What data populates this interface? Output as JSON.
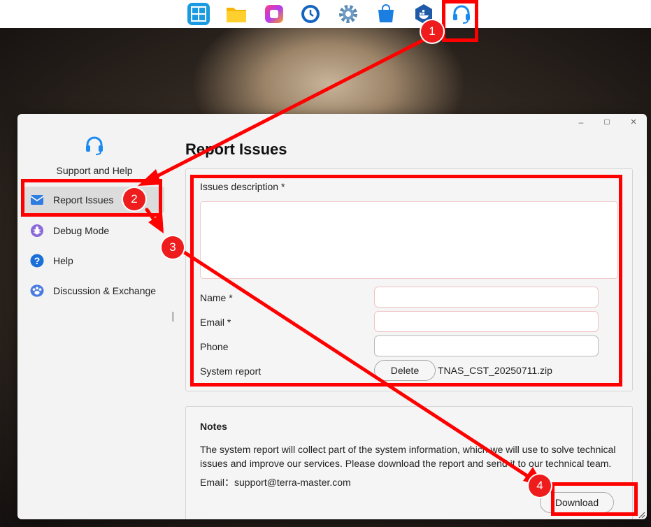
{
  "dock": {
    "icons": [
      "control-panel-icon",
      "file-manager-icon",
      "photos-app-icon",
      "backup-icon",
      "settings-icon",
      "app-center-icon",
      "docker-icon",
      "support-headset-icon"
    ]
  },
  "window": {
    "controls": {
      "minimize": "–",
      "maximize": "▢",
      "close": "×"
    },
    "brand_label": "Support and Help",
    "nav": [
      {
        "label": "Report Issues",
        "icon": "report-envelope-icon",
        "active": true
      },
      {
        "label": "Debug Mode",
        "icon": "bug-icon",
        "active": false
      },
      {
        "label": "Help",
        "icon": "help-question-icon",
        "active": false
      },
      {
        "label": "Discussion & Exchange",
        "icon": "community-icon",
        "active": false
      }
    ],
    "page_title": "Report Issues",
    "form": {
      "issues_label": "Issues description *",
      "name_label": "Name *",
      "email_label": "Email *",
      "phone_label": "Phone",
      "system_report_label": "System report",
      "delete_button": "Delete",
      "filename": "TNAS_CST_20250711.zip"
    },
    "notes": {
      "title": "Notes",
      "body": "The system report will collect part of the system information, which we will use to solve technical issues and improve our services. Please download the report and send it to our technical team.",
      "email": "Email：support@terra-master.com"
    },
    "download_button": "Download"
  },
  "annotations": {
    "steps": [
      "1",
      "2",
      "3",
      "4"
    ],
    "color": "#ff0000"
  }
}
